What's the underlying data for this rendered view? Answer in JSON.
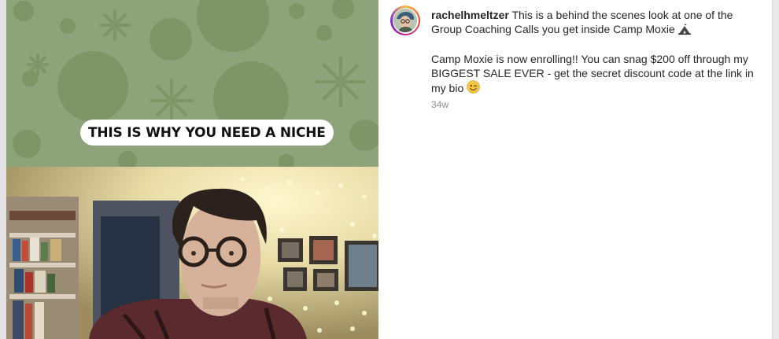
{
  "post": {
    "username": "rachelhmeltzer",
    "caption_line1": "This is a behind the scenes look at one of the Group Coaching Calls you get inside Camp Moxie",
    "caption_line2": "Camp Moxie is now enrolling!! You can snag $200 off through my BIGGEST SALE EVER - get the secret discount code at the link in my bio",
    "timestamp": "34w"
  },
  "video": {
    "overlay_text": "THIS IS WHY YOU NEED A NICHE"
  },
  "icons": {
    "camp_emoji": "camping-tent-icon",
    "wink_emoji": "winking-face-icon"
  },
  "colors": {
    "background_green": "#8da37a",
    "text_primary": "#262626",
    "text_secondary": "#8e8e8e"
  }
}
